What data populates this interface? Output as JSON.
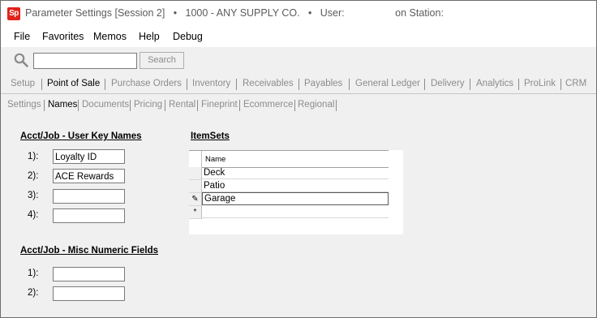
{
  "window": {
    "title": "Parameter Settings [Session 2]   •   1000 - ANY SUPPLY CO.   •   User:                  on Station:",
    "app_icon_label": "Sp"
  },
  "menu": {
    "items": [
      "File",
      "Favorites",
      "Memos",
      "Help",
      "Debug"
    ]
  },
  "search": {
    "value": "",
    "button_label": "Search"
  },
  "main_tabs": [
    {
      "label": "Setup",
      "active": false
    },
    {
      "label": "Point of Sale",
      "active": true
    },
    {
      "label": "Purchase Orders",
      "active": false
    },
    {
      "label": "Inventory",
      "active": false
    },
    {
      "label": "Receivables",
      "active": false
    },
    {
      "label": "Payables",
      "active": false
    },
    {
      "label": "General Ledger",
      "active": false
    },
    {
      "label": "Delivery",
      "active": false
    },
    {
      "label": "Analytics",
      "active": false
    },
    {
      "label": "ProLink",
      "active": false
    },
    {
      "label": "CRM",
      "active": false
    }
  ],
  "sub_tabs": [
    {
      "label": "Settings",
      "active": false
    },
    {
      "label": "Names",
      "active": true
    },
    {
      "label": "Documents",
      "active": false
    },
    {
      "label": "Pricing",
      "active": false
    },
    {
      "label": "Rental",
      "active": false
    },
    {
      "label": "Fineprint",
      "active": false
    },
    {
      "label": "Ecommerce",
      "active": false
    },
    {
      "label": "Regional",
      "active": false
    }
  ],
  "user_key_names": {
    "heading": "Acct/Job - User Key Names",
    "fields": [
      {
        "label": "1):",
        "value": "Loyalty ID"
      },
      {
        "label": "2):",
        "value": "ACE Rewards"
      },
      {
        "label": "3):",
        "value": ""
      },
      {
        "label": "4):",
        "value": ""
      }
    ]
  },
  "misc_numeric": {
    "heading": "Acct/Job - Misc Numeric Fields",
    "fields": [
      {
        "label": "1):",
        "value": ""
      },
      {
        "label": "2):",
        "value": ""
      }
    ]
  },
  "itemsets": {
    "heading": "ItemSets",
    "column_name": "Name",
    "rows": [
      {
        "indicator": "",
        "name": "Deck"
      },
      {
        "indicator": "",
        "name": "Patio"
      },
      {
        "indicator": "✎",
        "name": "Garage"
      },
      {
        "indicator": "*",
        "name": ""
      }
    ]
  }
}
